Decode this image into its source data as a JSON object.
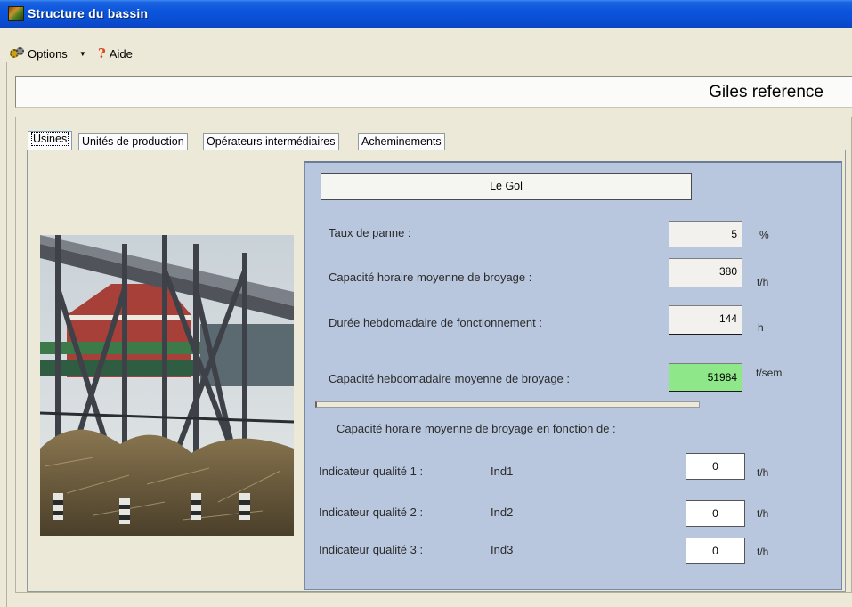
{
  "window": {
    "title": "Structure du bassin"
  },
  "menu": {
    "options_label": "Options",
    "aide_label": "Aide",
    "help_glyph": "?"
  },
  "header": {
    "scenario_name": "Giles reference"
  },
  "tabs": [
    {
      "label": "Usines",
      "active": true
    },
    {
      "label": "Unités de production",
      "active": false
    },
    {
      "label": "Opérateurs intermédiaires",
      "active": false
    },
    {
      "label": "Acheminements",
      "active": false
    }
  ],
  "factory": {
    "name": "Le Gol"
  },
  "params": {
    "taux_panne": {
      "label": "Taux de panne :",
      "value": "5",
      "unit": "%"
    },
    "capacite_horaire": {
      "label": "Capacité horaire moyenne de broyage :",
      "value": "380",
      "unit": "t/h"
    },
    "duree_hebdo": {
      "label": "Durée hebdomadaire de fonctionnement :",
      "value": "144",
      "unit": "h"
    },
    "capacite_hebdo": {
      "label": "Capacité hebdomadaire moyenne de broyage :",
      "value": "51984",
      "unit": "t/sem"
    }
  },
  "quality": {
    "section_title": "Capacité horaire moyenne de broyage en fonction de :",
    "rows": [
      {
        "label": "Indicateur qualité 1 :",
        "code": "Ind1",
        "value": "0",
        "unit": "t/h"
      },
      {
        "label": "Indicateur qualité 2 :",
        "code": "Ind2",
        "value": "0",
        "unit": "t/h"
      },
      {
        "label": "Indicateur qualité 3 :",
        "code": "Ind3",
        "value": "0",
        "unit": "t/h"
      }
    ]
  },
  "colors": {
    "title_bar": "#0a55dc",
    "panel_blue": "#b8c7de",
    "computed_green": "#8ee88a"
  }
}
